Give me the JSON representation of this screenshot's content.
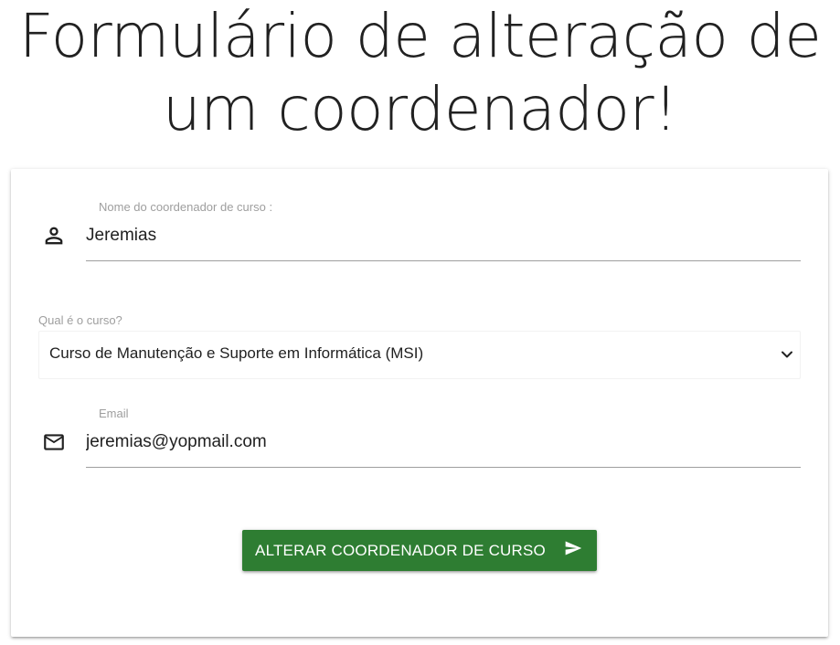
{
  "page": {
    "title_line1": "Formulário de alteração de",
    "title_line2": "um coordenador!"
  },
  "form": {
    "name_field": {
      "label": "Nome do coordenador de curso :",
      "value": "Jeremias",
      "icon": "person-icon"
    },
    "course_select": {
      "label": "Qual é o curso?",
      "selected": "Curso de Manutenção e Suporte em Informática (MSI)",
      "icon": "chevron-down-icon"
    },
    "email_field": {
      "label": "Email",
      "value": "jeremias@yopmail.com",
      "icon": "mail-icon"
    },
    "submit": {
      "label": "ALTERAR COORDENADOR DE CURSO",
      "icon": "send-icon",
      "color": "#2e7d32"
    }
  },
  "colors": {
    "label": "#9e9e9e",
    "text": "#212121",
    "button": "#2e7d32"
  }
}
